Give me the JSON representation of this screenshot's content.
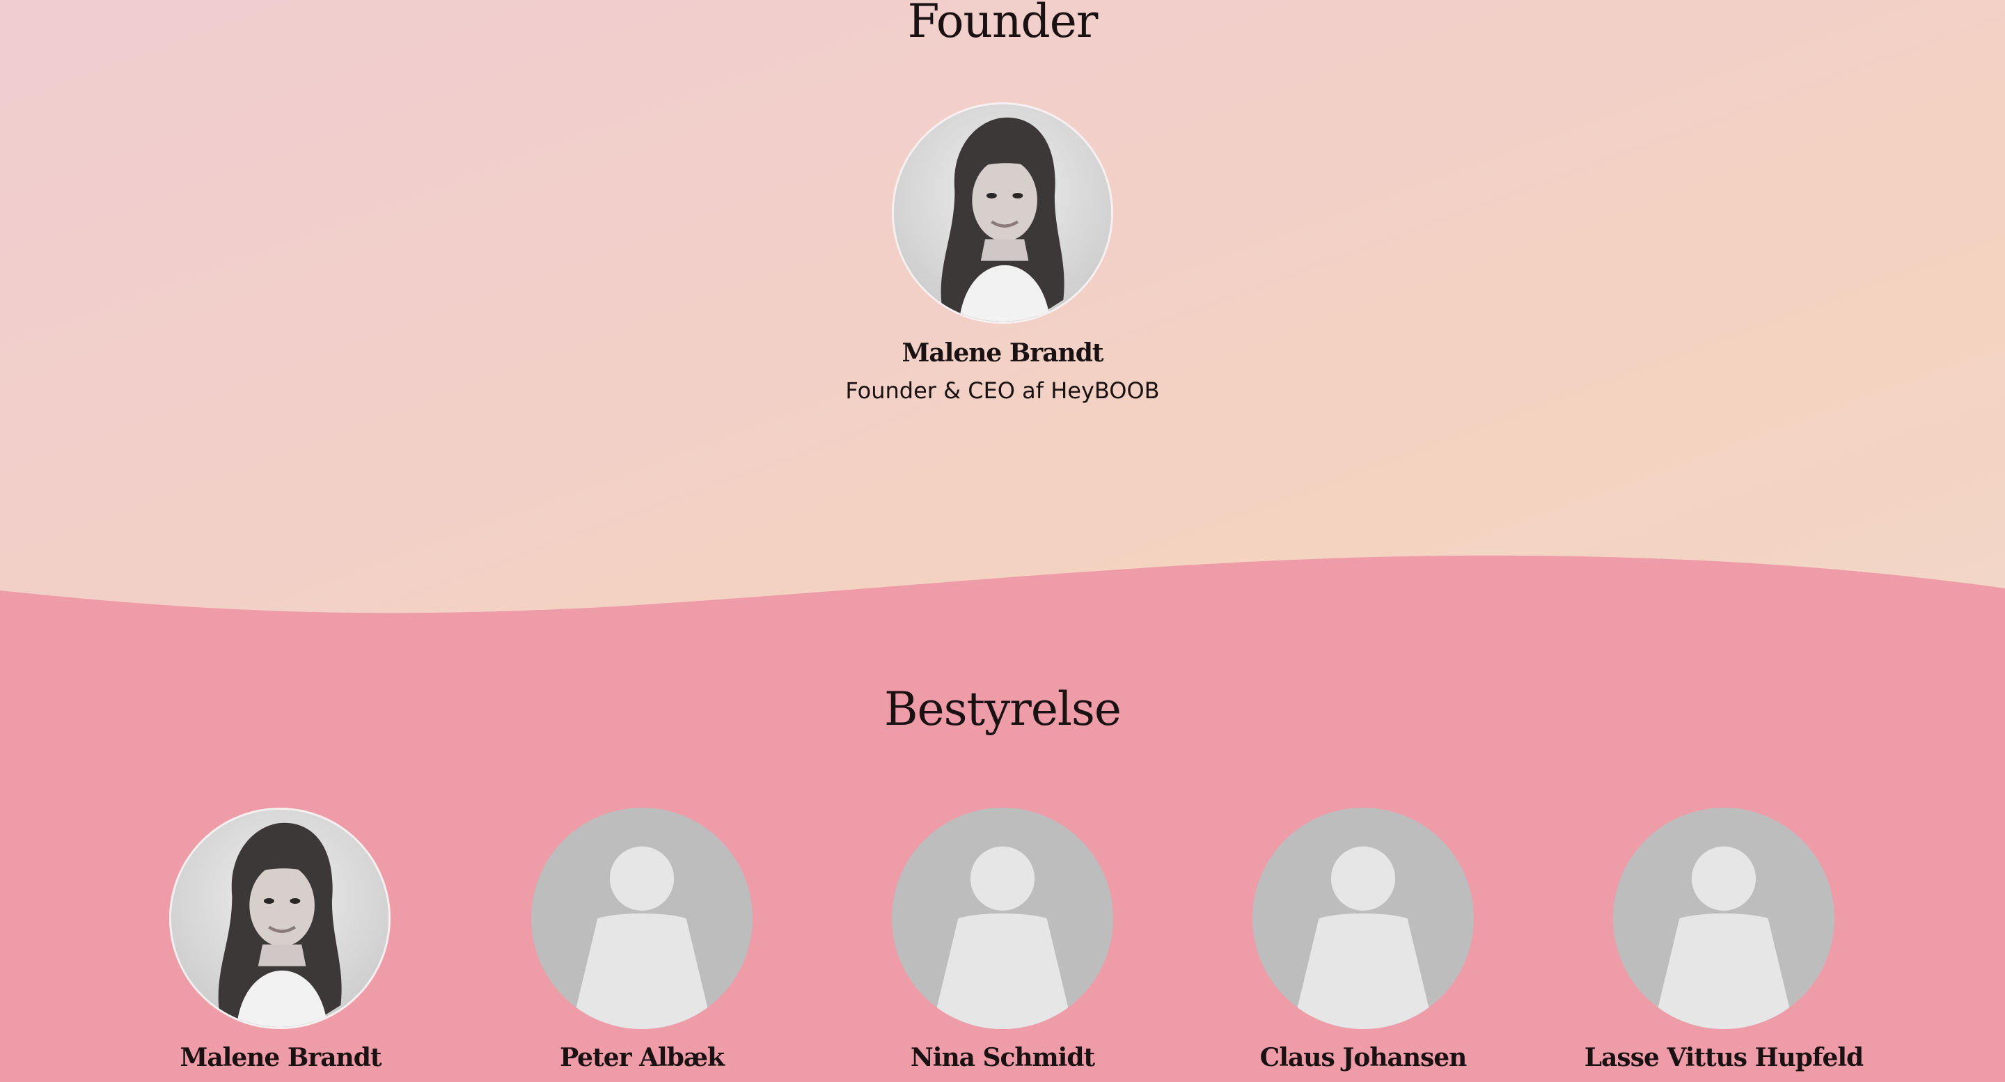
{
  "founder_section": {
    "title": "Founder",
    "person": {
      "name": "Malene Brandt",
      "role": "Founder & CEO af HeyBOOB",
      "avatar": "portrait-photo"
    }
  },
  "board_section": {
    "title": "Bestyrelse",
    "members": [
      {
        "name": "Malene Brandt",
        "avatar": "portrait-photo"
      },
      {
        "name": "Peter Albæk",
        "avatar": "placeholder-avatar-icon"
      },
      {
        "name": "Nina Schmidt",
        "avatar": "placeholder-avatar-icon"
      },
      {
        "name": "Claus Johansen",
        "avatar": "placeholder-avatar-icon"
      },
      {
        "name": "Lasse Vittus Hupfeld",
        "avatar": "placeholder-avatar-icon"
      }
    ]
  },
  "colors": {
    "top_background": "#f2d0c8",
    "bottom_background": "#ef9ca9",
    "placeholder_circle": "#bdbdbd",
    "placeholder_figure": "#e6e6e6",
    "text": "#1a1212"
  }
}
